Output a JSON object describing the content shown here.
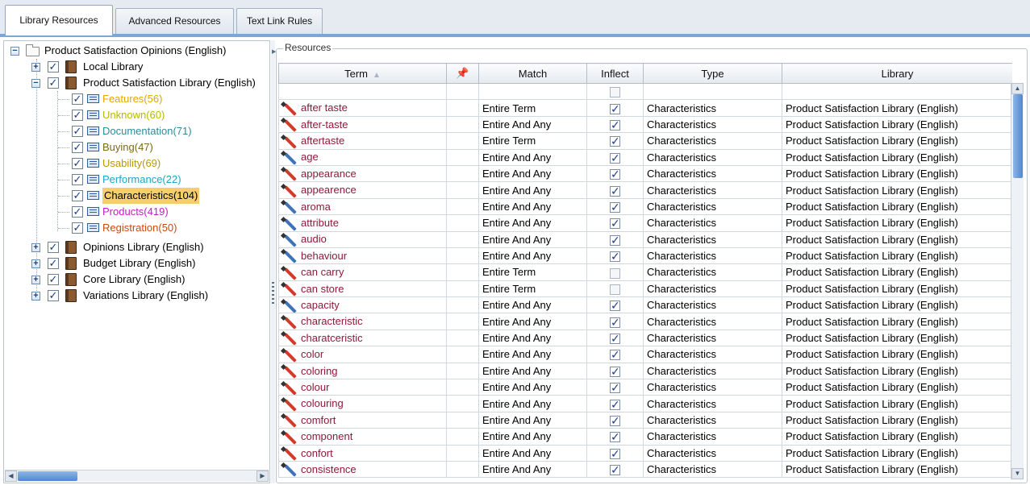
{
  "tabs": [
    {
      "label": "Library Resources",
      "active": true
    },
    {
      "label": "Advanced Resources",
      "active": false
    },
    {
      "label": "Text Link Rules",
      "active": false
    }
  ],
  "tree": {
    "root": "Product Satisfaction Opinions (English)",
    "libraries": {
      "local": "Local Library",
      "product": "Product Satisfaction Library (English)",
      "opinions": "Opinions Library (English)",
      "budget": "Budget Library (English)",
      "core": "Core Library (English)",
      "variations": "Variations Library (English)"
    },
    "types": [
      {
        "label": "Features(56)",
        "color": "#e0a800"
      },
      {
        "label": "Unknown(60)",
        "color": "#b8b800"
      },
      {
        "label": "Documentation(71)",
        "color": "#2e8b9a"
      },
      {
        "label": "Buying(47)",
        "color": "#7a6a1a"
      },
      {
        "label": "Usability(69)",
        "color": "#b89a00"
      },
      {
        "label": "Performance(22)",
        "color": "#1aa6c4"
      },
      {
        "label": "Characteristics(104)",
        "color": "#000000",
        "selected": true
      },
      {
        "label": "Products(419)",
        "color": "#c020c0"
      },
      {
        "label": "Registration(50)",
        "color": "#c84a10"
      }
    ]
  },
  "resources": {
    "title": "Resources",
    "columns": {
      "term": "Term",
      "match": "Match",
      "inflect": "Inflect",
      "type": "Type",
      "library": "Library"
    },
    "rows": [
      {
        "term": "after taste",
        "match": "Entire Term",
        "inflect": true,
        "type": "Characteristics",
        "library": "Product Satisfaction Library (English)",
        "icon": "red"
      },
      {
        "term": "after-taste",
        "match": "Entire And Any",
        "inflect": true,
        "type": "Characteristics",
        "library": "Product Satisfaction Library (English)",
        "icon": "red"
      },
      {
        "term": "aftertaste",
        "match": "Entire Term",
        "inflect": true,
        "type": "Characteristics",
        "library": "Product Satisfaction Library (English)",
        "icon": "red"
      },
      {
        "term": "age",
        "match": "Entire And Any",
        "inflect": true,
        "type": "Characteristics",
        "library": "Product Satisfaction Library (English)",
        "icon": "blue"
      },
      {
        "term": "appearance",
        "match": "Entire And Any",
        "inflect": true,
        "type": "Characteristics",
        "library": "Product Satisfaction Library (English)",
        "icon": "red"
      },
      {
        "term": "appearence",
        "match": "Entire And Any",
        "inflect": true,
        "type": "Characteristics",
        "library": "Product Satisfaction Library (English)",
        "icon": "red"
      },
      {
        "term": "aroma",
        "match": "Entire And Any",
        "inflect": true,
        "type": "Characteristics",
        "library": "Product Satisfaction Library (English)",
        "icon": "blue"
      },
      {
        "term": "attribute",
        "match": "Entire And Any",
        "inflect": true,
        "type": "Characteristics",
        "library": "Product Satisfaction Library (English)",
        "icon": "blue"
      },
      {
        "term": "audio",
        "match": "Entire And Any",
        "inflect": true,
        "type": "Characteristics",
        "library": "Product Satisfaction Library (English)",
        "icon": "blue"
      },
      {
        "term": "behaviour",
        "match": "Entire And Any",
        "inflect": true,
        "type": "Characteristics",
        "library": "Product Satisfaction Library (English)",
        "icon": "blue"
      },
      {
        "term": "can carry",
        "match": "Entire Term",
        "inflect": false,
        "type": "Characteristics",
        "library": "Product Satisfaction Library (English)",
        "icon": "red"
      },
      {
        "term": "can store",
        "match": "Entire Term",
        "inflect": false,
        "type": "Characteristics",
        "library": "Product Satisfaction Library (English)",
        "icon": "red"
      },
      {
        "term": "capacity",
        "match": "Entire And Any",
        "inflect": true,
        "type": "Characteristics",
        "library": "Product Satisfaction Library (English)",
        "icon": "blue"
      },
      {
        "term": "characteristic",
        "match": "Entire And Any",
        "inflect": true,
        "type": "Characteristics",
        "library": "Product Satisfaction Library (English)",
        "icon": "red"
      },
      {
        "term": "charatceristic",
        "match": "Entire And Any",
        "inflect": true,
        "type": "Characteristics",
        "library": "Product Satisfaction Library (English)",
        "icon": "red"
      },
      {
        "term": "color",
        "match": "Entire And Any",
        "inflect": true,
        "type": "Characteristics",
        "library": "Product Satisfaction Library (English)",
        "icon": "red"
      },
      {
        "term": "coloring",
        "match": "Entire And Any",
        "inflect": true,
        "type": "Characteristics",
        "library": "Product Satisfaction Library (English)",
        "icon": "red"
      },
      {
        "term": "colour",
        "match": "Entire And Any",
        "inflect": true,
        "type": "Characteristics",
        "library": "Product Satisfaction Library (English)",
        "icon": "red"
      },
      {
        "term": "colouring",
        "match": "Entire And Any",
        "inflect": true,
        "type": "Characteristics",
        "library": "Product Satisfaction Library (English)",
        "icon": "red"
      },
      {
        "term": "comfort",
        "match": "Entire And Any",
        "inflect": true,
        "type": "Characteristics",
        "library": "Product Satisfaction Library (English)",
        "icon": "red"
      },
      {
        "term": "component",
        "match": "Entire And Any",
        "inflect": true,
        "type": "Characteristics",
        "library": "Product Satisfaction Library (English)",
        "icon": "red"
      },
      {
        "term": "confort",
        "match": "Entire And Any",
        "inflect": true,
        "type": "Characteristics",
        "library": "Product Satisfaction Library (English)",
        "icon": "red"
      },
      {
        "term": "consistence",
        "match": "Entire And Any",
        "inflect": true,
        "type": "Characteristics",
        "library": "Product Satisfaction Library (English)",
        "icon": "blue"
      }
    ]
  },
  "icons": {
    "pin_column": "pin-icon",
    "sort": "sort-ascending-icon",
    "edit_user": "pencil-red-icon",
    "edit_lib": "pencil-blue-icon"
  }
}
